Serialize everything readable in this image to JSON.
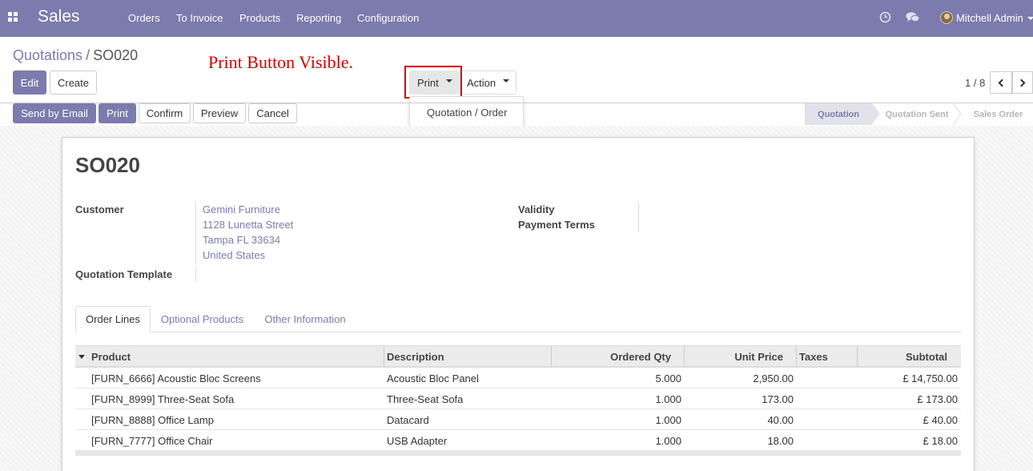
{
  "navbar": {
    "app_name": "Sales",
    "menu": [
      "Orders",
      "To Invoice",
      "Products",
      "Reporting",
      "Configuration"
    ],
    "user_name": "Mitchell Admin",
    "icons": [
      "apps-icon",
      "clock-icon",
      "chat-icon",
      "avatar",
      "caret-down-icon"
    ],
    "bar_color": "#7c7bad"
  },
  "breadcrumb": {
    "parent": "Quotations",
    "separator": "/",
    "current": "SO020"
  },
  "annotation": "Print Button Visible.",
  "buttons": {
    "edit": "Edit",
    "create": "Create",
    "print_dd": "Print",
    "action_dd": "Action",
    "send_email": "Send by Email",
    "print": "Print",
    "confirm": "Confirm",
    "preview": "Preview",
    "cancel": "Cancel"
  },
  "print_menu": [
    "Quotation / Order"
  ],
  "pager": {
    "value": "1 / 8"
  },
  "statusbar": {
    "stages": [
      "Quotation",
      "Quotation Sent",
      "Sales Order"
    ],
    "active": "Quotation"
  },
  "form": {
    "name": "SO020",
    "customer_label": "Customer",
    "customer_address": [
      "Gemini Furniture",
      "1128 Lunetta Street",
      "Tampa FL 33634",
      "United States"
    ],
    "template_label": "Quotation Template",
    "validity_label": "Validity",
    "payment_terms_label": "Payment Terms"
  },
  "tabs": [
    "Order Lines",
    "Optional Products",
    "Other Information"
  ],
  "order_lines": {
    "columns": [
      "Product",
      "Description",
      "Ordered Qty",
      "Unit Price",
      "Taxes",
      "Subtotal"
    ],
    "rows": [
      {
        "product": "[FURN_6666] Acoustic Bloc Screens",
        "description": "Acoustic Bloc Panel",
        "qty": "5.000",
        "price": "2,950.00",
        "taxes": "",
        "subtotal": "£ 14,750.00"
      },
      {
        "product": "[FURN_8999] Three-Seat Sofa",
        "description": "Three-Seat Sofa",
        "qty": "1.000",
        "price": "173.00",
        "taxes": "",
        "subtotal": "£ 173.00"
      },
      {
        "product": "[FURN_8888] Office Lamp",
        "description": "Datacard",
        "qty": "1.000",
        "price": "40.00",
        "taxes": "",
        "subtotal": "£ 40.00"
      },
      {
        "product": "[FURN_7777] Office Chair",
        "description": "USB Adapter",
        "qty": "1.000",
        "price": "18.00",
        "taxes": "",
        "subtotal": "£ 18.00"
      }
    ]
  }
}
